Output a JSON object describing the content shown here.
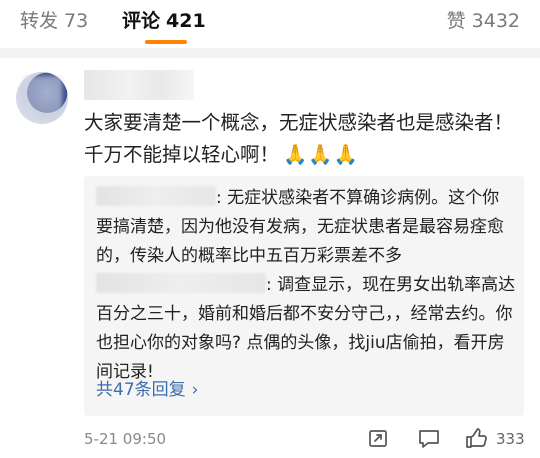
{
  "tabs": {
    "repost_label": "转发",
    "repost_count": "73",
    "comments_label": "评论",
    "comments_count": "421",
    "likes_label": "赞",
    "likes_count": "3432"
  },
  "comment": {
    "text": "大家要清楚一个概念，无症状感染者也是感染者！千万不能掉以轻心啊！",
    "emoji": "🙏🙏🙏",
    "time": "5-21 09:50",
    "like_count": "333"
  },
  "replies": [
    {
      "text": ": 无症状感染者不算确诊病例。这个你要搞清楚，因为他没有发病，无症状患者是最容易痊愈的，传染人的概率比中五百万彩票差不多"
    },
    {
      "text": ": 调查显示，现在男女出轨率高达百分之三十，婚前和婚后都不安分守己，，经常去约。你也担心你的对象吗? 点偶的头像，找jiu店偷拍，看开房间记录!"
    }
  ],
  "more_replies": "共47条回复",
  "colors": {
    "accent": "#ff8200",
    "link": "#3d6dad",
    "reply_bg": "#f5f5f5"
  },
  "icons": [
    "share-icon",
    "comment-icon",
    "like-icon",
    "chevron-right-icon"
  ]
}
